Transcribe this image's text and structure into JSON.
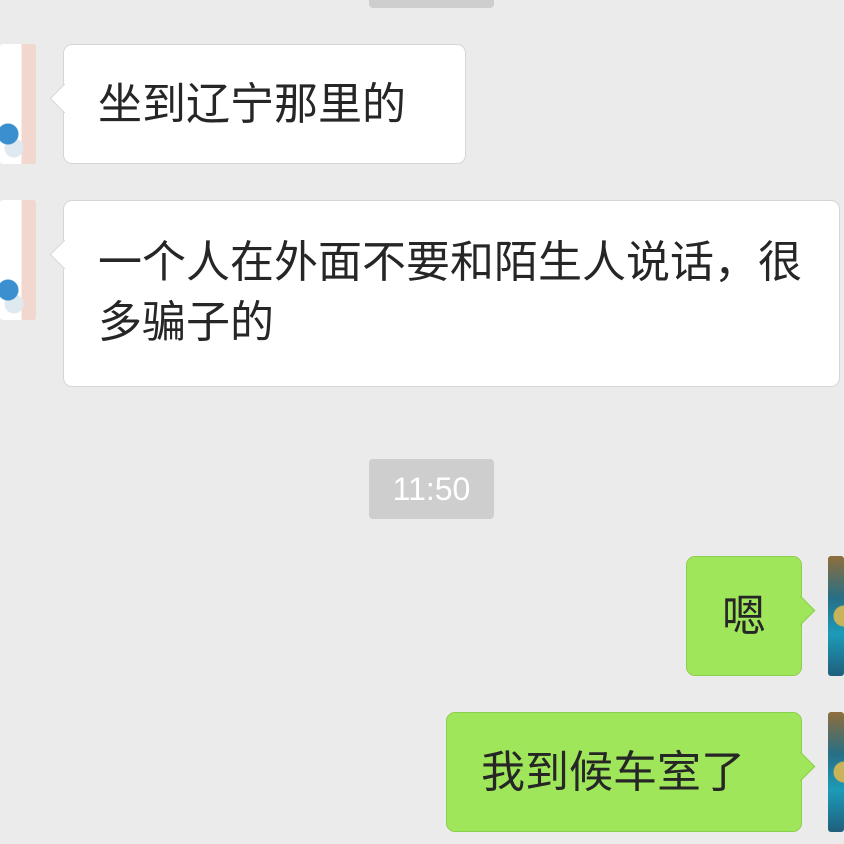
{
  "chat": {
    "timestamps": {
      "middle": "11:50"
    },
    "messages": [
      {
        "side": "left",
        "text": "坐到辽宁那里的"
      },
      {
        "side": "left",
        "text": "一个人在外面不要和陌生人说话，很多骗子的"
      },
      {
        "side": "right",
        "text": "嗯"
      },
      {
        "side": "right",
        "text": "我到候车室了"
      }
    ]
  },
  "colors": {
    "background": "#ebebeb",
    "incoming_bubble": "#ffffff",
    "outgoing_bubble": "#9fe65b",
    "timestamp_bg": "#cecece",
    "timestamp_text": "#ffffff"
  },
  "icons": {
    "incoming_avatar": "avatar-image",
    "outgoing_avatar": "avatar-image"
  }
}
